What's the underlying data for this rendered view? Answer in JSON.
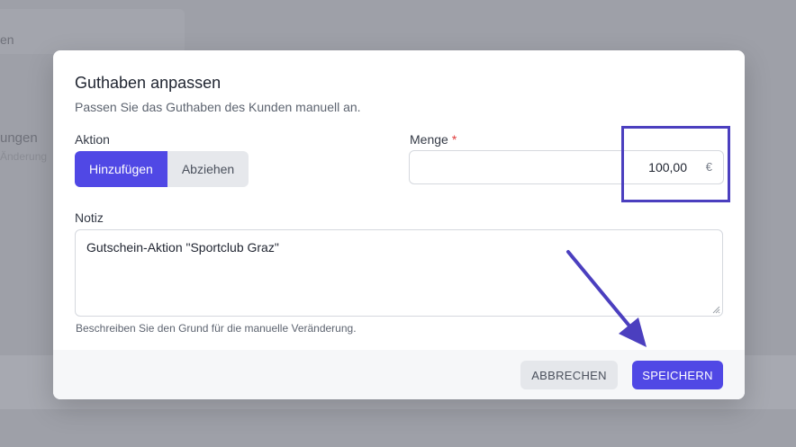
{
  "background": {
    "text1": "en",
    "text2": "ungen",
    "text3": "Änderung"
  },
  "dialog": {
    "title": "Guthaben anpassen",
    "subtitle": "Passen Sie das Guthaben des Kunden manuell an.",
    "action_label": "Aktion",
    "action_options": [
      "Hinzufügen",
      "Abziehen"
    ],
    "action_selected": "Hinzufügen",
    "amount_label": "Menge",
    "amount_required_mark": "*",
    "amount_value": "100,00",
    "currency_symbol": "€",
    "note_label": "Notiz",
    "note_value": "Gutschein-Aktion \"Sportclub Graz\"",
    "note_hint": "Beschreiben Sie den Grund für die manuelle Veränderung.",
    "cancel_label": "ABBRECHEN",
    "save_label": "SPEICHERN"
  },
  "colors": {
    "accent": "#5048e5",
    "annotation": "#4b3fbf",
    "required": "#e03b3b"
  },
  "icons": {
    "resize": "resize-grip-icon",
    "annotation_arrow": "arrow-icon"
  }
}
